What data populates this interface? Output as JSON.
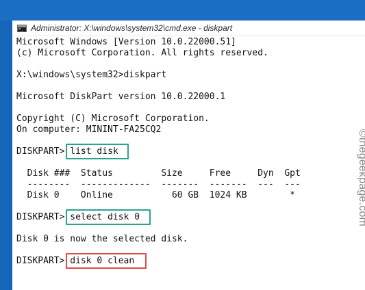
{
  "window": {
    "title": "Administrator: X:\\windows\\system32\\cmd.exe - diskpart",
    "icon": "cmd-console-icon"
  },
  "console": {
    "banner_line1": "Microsoft Windows [Version 10.0.22000.51]",
    "banner_line2": "(c) Microsoft Corporation. All rights reserved.",
    "prompt_cmd": "X:\\windows\\system32>diskpart",
    "diskpart_version": "Microsoft DiskPart version 10.0.22000.1",
    "copyright": "Copyright (C) Microsoft Corporation.",
    "computer": "On computer: MININT-FA25CQ2",
    "cmd1_prompt": "DISKPART> ",
    "cmd1": "list disk",
    "table_header": "  Disk ###  Status         Size     Free     Dyn  Gpt",
    "table_divider": "  --------  -------------  -------  -------  ---  ---",
    "table_row": "  Disk 0    Online           60 GB  1024 KB        *",
    "cmd2_prompt": "DISKPART> ",
    "cmd2": "select disk 0",
    "select_result": "Disk 0 is now the selected disk.",
    "cmd3_prompt": "DISKPART> ",
    "cmd3": "disk 0 clean"
  },
  "highlight_colors": {
    "teal": "#2aa38f",
    "red": "#e04a4a"
  },
  "watermark": "©thegeekpage.com"
}
